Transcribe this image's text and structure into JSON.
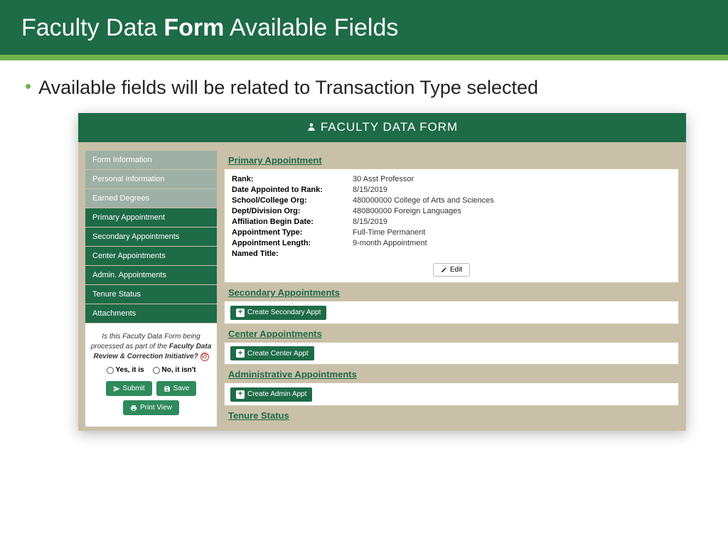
{
  "slide": {
    "title_part1": "Faculty Data ",
    "title_bold": "Form",
    "title_part2": " Available Fields",
    "bullet": "Available fields will be related to Transaction Type selected"
  },
  "app": {
    "header": "FACULTY DATA FORM",
    "nav": [
      {
        "label": "Form Information",
        "muted": true
      },
      {
        "label": "Personal Information",
        "muted": true
      },
      {
        "label": "Earned Degrees",
        "muted": true
      },
      {
        "label": "Primary Appointment",
        "muted": false
      },
      {
        "label": "Secondary Appointments",
        "muted": false
      },
      {
        "label": "Center Appointments",
        "muted": false
      },
      {
        "label": "Admin. Appointments",
        "muted": false
      },
      {
        "label": "Tenure Status",
        "muted": false
      },
      {
        "label": "Attachments",
        "muted": false
      }
    ],
    "initiative_q1": "Is this Faculty Data Form being processed as part of the ",
    "initiative_q2": "Faculty Data Review & Correction Initiative?",
    "radio_yes": "Yes, it is",
    "radio_no": "No, it isn't",
    "submit": "Submit",
    "save": "Save",
    "print": "Print View",
    "sections": {
      "primary_title": "Primary Appointment",
      "primary_fields": [
        {
          "label": "Rank:",
          "value": "30 Asst Professor"
        },
        {
          "label": "Date Appointed to Rank:",
          "value": "8/15/2019"
        },
        {
          "label": "School/College Org:",
          "value": "480000000 College of Arts and Sciences"
        },
        {
          "label": "Dept/Division Org:",
          "value": "480800000 Foreign Languages"
        },
        {
          "label": "Affiliation Begin Date:",
          "value": "8/15/2019"
        },
        {
          "label": "Appointment Type:",
          "value": "Full-Time Permanent"
        },
        {
          "label": "Appointment Length:",
          "value": "9-month Appointment"
        },
        {
          "label": "Named Title:",
          "value": ""
        }
      ],
      "edit": "Edit",
      "secondary_title": "Secondary Appointments",
      "secondary_btn": "Create Secondary Appt",
      "center_title": "Center Appointments",
      "center_btn": "Create Center Appt",
      "admin_title": "Administrative Appointments",
      "admin_btn": "Create Admin Appt",
      "tenure_title": "Tenure Status"
    }
  }
}
